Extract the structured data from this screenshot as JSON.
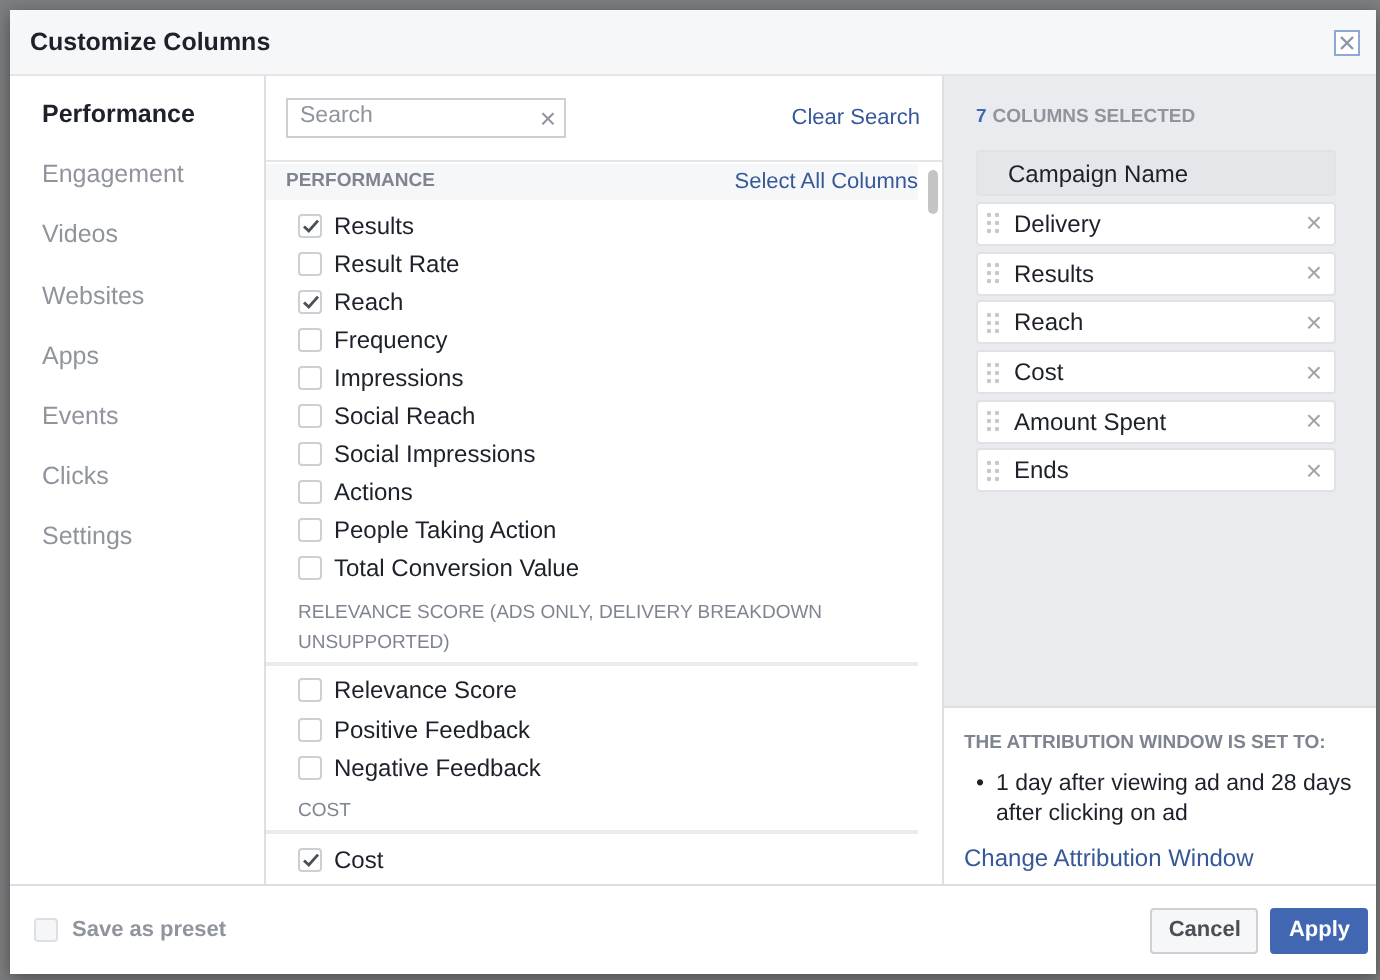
{
  "dialog": {
    "title": "Customize Columns"
  },
  "nav": [
    {
      "label": "Performance",
      "selected": true
    },
    {
      "label": "Engagement",
      "selected": false
    },
    {
      "label": "Videos",
      "selected": false
    },
    {
      "label": "Websites",
      "selected": false
    },
    {
      "label": "Apps",
      "selected": false
    },
    {
      "label": "Events",
      "selected": false
    },
    {
      "label": "Clicks",
      "selected": false
    },
    {
      "label": "Settings",
      "selected": false
    }
  ],
  "search": {
    "placeholder": "Search",
    "clear_icon": "×",
    "clear_link": "Clear Search"
  },
  "sections": [
    {
      "kind": "banded",
      "heading": "PERFORMANCE",
      "action": "Select All Columns",
      "items": [
        {
          "label": "Results",
          "checked": true
        },
        {
          "label": "Result Rate",
          "checked": false
        },
        {
          "label": "Reach",
          "checked": true
        },
        {
          "label": "Frequency",
          "checked": false
        },
        {
          "label": "Impressions",
          "checked": false
        },
        {
          "label": "Social Reach",
          "checked": false
        },
        {
          "label": "Social Impressions",
          "checked": false
        },
        {
          "label": "Actions",
          "checked": false
        },
        {
          "label": "People Taking Action",
          "checked": false
        },
        {
          "label": "Total Conversion Value",
          "checked": false
        }
      ]
    },
    {
      "kind": "plain",
      "heading": "RELEVANCE SCORE (ADS ONLY, DELIVERY BREAKDOWN UNSUPPORTED)",
      "items": [
        {
          "label": "Relevance Score",
          "checked": false
        },
        {
          "label": "Positive Feedback",
          "checked": false
        },
        {
          "label": "Negative Feedback",
          "checked": false
        }
      ]
    },
    {
      "kind": "plain",
      "heading": "COST",
      "items": [
        {
          "label": "Cost",
          "checked": true
        }
      ]
    }
  ],
  "selected_panel": {
    "count": "7",
    "label": "COLUMNS SELECTED",
    "columns": [
      {
        "label": "Campaign Name",
        "kind": "fixed"
      },
      {
        "label": "Delivery",
        "kind": "movable",
        "remove": "×"
      },
      {
        "label": "Results",
        "kind": "movable",
        "remove": "×"
      },
      {
        "label": "Reach",
        "kind": "movable",
        "remove": "×"
      },
      {
        "label": "Cost",
        "kind": "movable",
        "remove": "×"
      },
      {
        "label": "Amount Spent",
        "kind": "movable",
        "remove": "×"
      },
      {
        "label": "Ends",
        "kind": "movable",
        "remove": "×"
      }
    ]
  },
  "attribution": {
    "heading": "THE ATTRIBUTION WINDOW IS SET TO:",
    "bullets": [
      {
        "marker": "•",
        "text": "1 day after viewing ad and 28 days after clicking on ad"
      }
    ],
    "link": "Change Attribution Window"
  },
  "footer": {
    "preset": {
      "label": "Save as preset",
      "checked": false,
      "disabled": true
    },
    "buttons": [
      {
        "label": "Cancel",
        "kind": "secondary"
      },
      {
        "label": "Apply",
        "kind": "primary"
      }
    ]
  }
}
